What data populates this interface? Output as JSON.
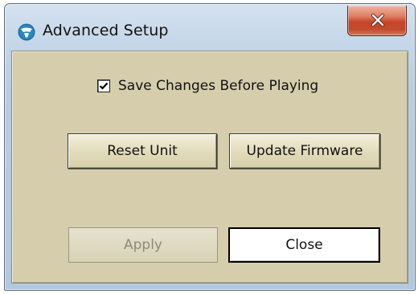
{
  "window": {
    "title": "Advanced Setup",
    "close_glyph": "X"
  },
  "options": {
    "save_changes_label": "Save Changes Before Playing",
    "save_changes_checked": true
  },
  "buttons": {
    "reset_unit": "Reset Unit",
    "update_firmware": "Update Firmware",
    "apply": "Apply",
    "close": "Close"
  },
  "icons": {
    "app": "app-logo-icon",
    "close": "close-icon",
    "check": "checkmark-icon"
  },
  "colors": {
    "client_background": "#d5cdac",
    "close_button": "#c8452a",
    "app_icon": "#1f6ea0"
  }
}
